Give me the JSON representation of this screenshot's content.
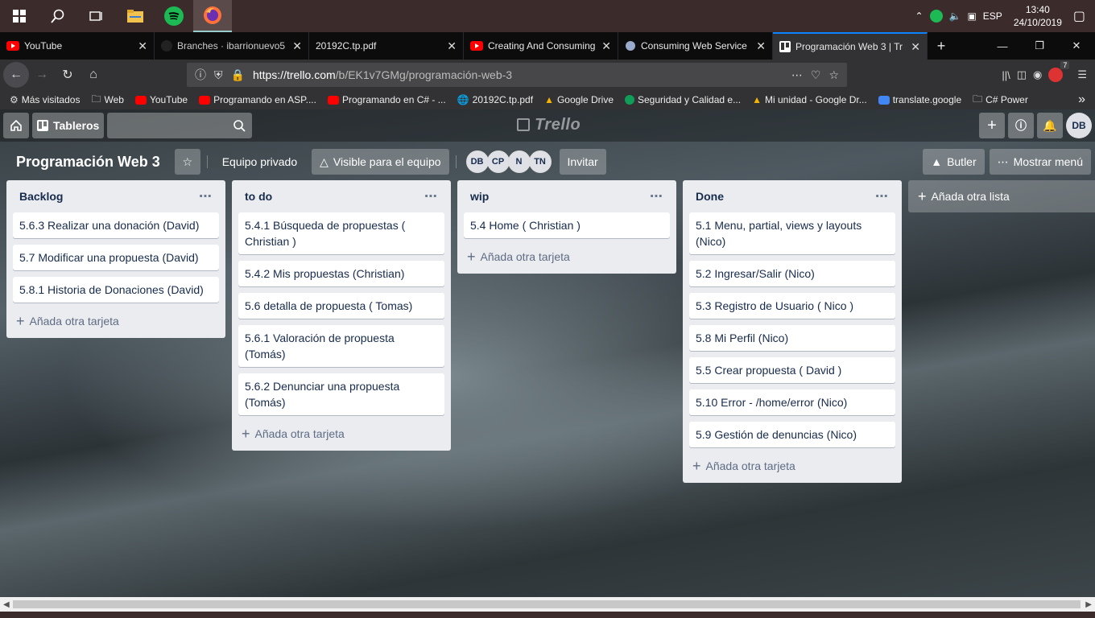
{
  "taskbar": {
    "lang": "ESP",
    "time": "13:40",
    "date": "24/10/2019"
  },
  "tabs": [
    {
      "title": "YouTube",
      "active": false
    },
    {
      "title": "Branches · ibarrionuevo5",
      "active": false
    },
    {
      "title": "20192C.tp.pdf",
      "active": false
    },
    {
      "title": "Creating And Consuming",
      "active": false
    },
    {
      "title": "Consuming Web Service",
      "active": false
    },
    {
      "title": "Programación Web 3 | Tr",
      "active": true
    }
  ],
  "nav": {
    "url_host": "https://trello.com",
    "url_path": "/b/EK1v7GMg/programación-web-3",
    "addon_badge": "7"
  },
  "bookmarks": [
    {
      "label": "Más visitados",
      "color": "#bbbbbb"
    },
    {
      "label": "Web",
      "color": "#cccccc"
    },
    {
      "label": "YouTube",
      "color": "#ff0000"
    },
    {
      "label": "Programando en ASP....",
      "color": "#ff0000"
    },
    {
      "label": "Programando en C# - ...",
      "color": "#ff0000"
    },
    {
      "label": "20192C.tp.pdf",
      "color": "#dddddd"
    },
    {
      "label": "Google Drive",
      "color": "#f4b400"
    },
    {
      "label": "Seguridad y Calidad e...",
      "color": "#0f9d58"
    },
    {
      "label": "Mi unidad - Google Dr...",
      "color": "#f4b400"
    },
    {
      "label": "translate.google",
      "color": "#4285f4"
    },
    {
      "label": "C# Power",
      "color": "#cccccc"
    }
  ],
  "header": {
    "boards_label": "Tableros",
    "logo": "Trello",
    "user_initials": "DB"
  },
  "board": {
    "title": "Programación Web 3",
    "team": "Equipo privado",
    "visibility": "Visible para el equipo",
    "members": [
      "DB",
      "CP",
      "N",
      "TN"
    ],
    "invite": "Invitar",
    "butler": "Butler",
    "menu": "Mostrar menú"
  },
  "lists": [
    {
      "title": "Backlog",
      "cards": [
        "5.6.3 Realizar una donación (David)",
        "5.7 Modificar una propuesta (David)",
        "5.8.1 Historia de Donaciones (David)"
      ],
      "add_label": "Añada otra tarjeta"
    },
    {
      "title": "to do",
      "cards": [
        "5.4.1 Búsqueda de propuestas ( Christian )",
        "5.4.2 Mis propuestas (Christian)",
        "5.6 detalla de propuesta ( Tomas)",
        "5.6.1 Valoración de propuesta (Tomás)",
        "5.6.2 Denunciar una propuesta (Tomás)"
      ],
      "add_label": "Añada otra tarjeta"
    },
    {
      "title": "wip",
      "cards": [
        "5.4 Home ( Christian )"
      ],
      "add_label": "Añada otra tarjeta"
    },
    {
      "title": "Done",
      "cards": [
        "5.1 Menu, partial, views y layouts (Nico)",
        "5.2 Ingresar/Salir (Nico)",
        "5.3 Registro de Usuario ( Nico )",
        "5.8 Mi Perfil (Nico)",
        "5.5 Crear propuesta ( David )",
        "5.10 Error - /home/error (Nico)",
        "5.9 Gestión de denuncias (Nico)"
      ],
      "add_label": "Añada otra tarjeta"
    }
  ],
  "add_list_label": "Añada otra lista"
}
